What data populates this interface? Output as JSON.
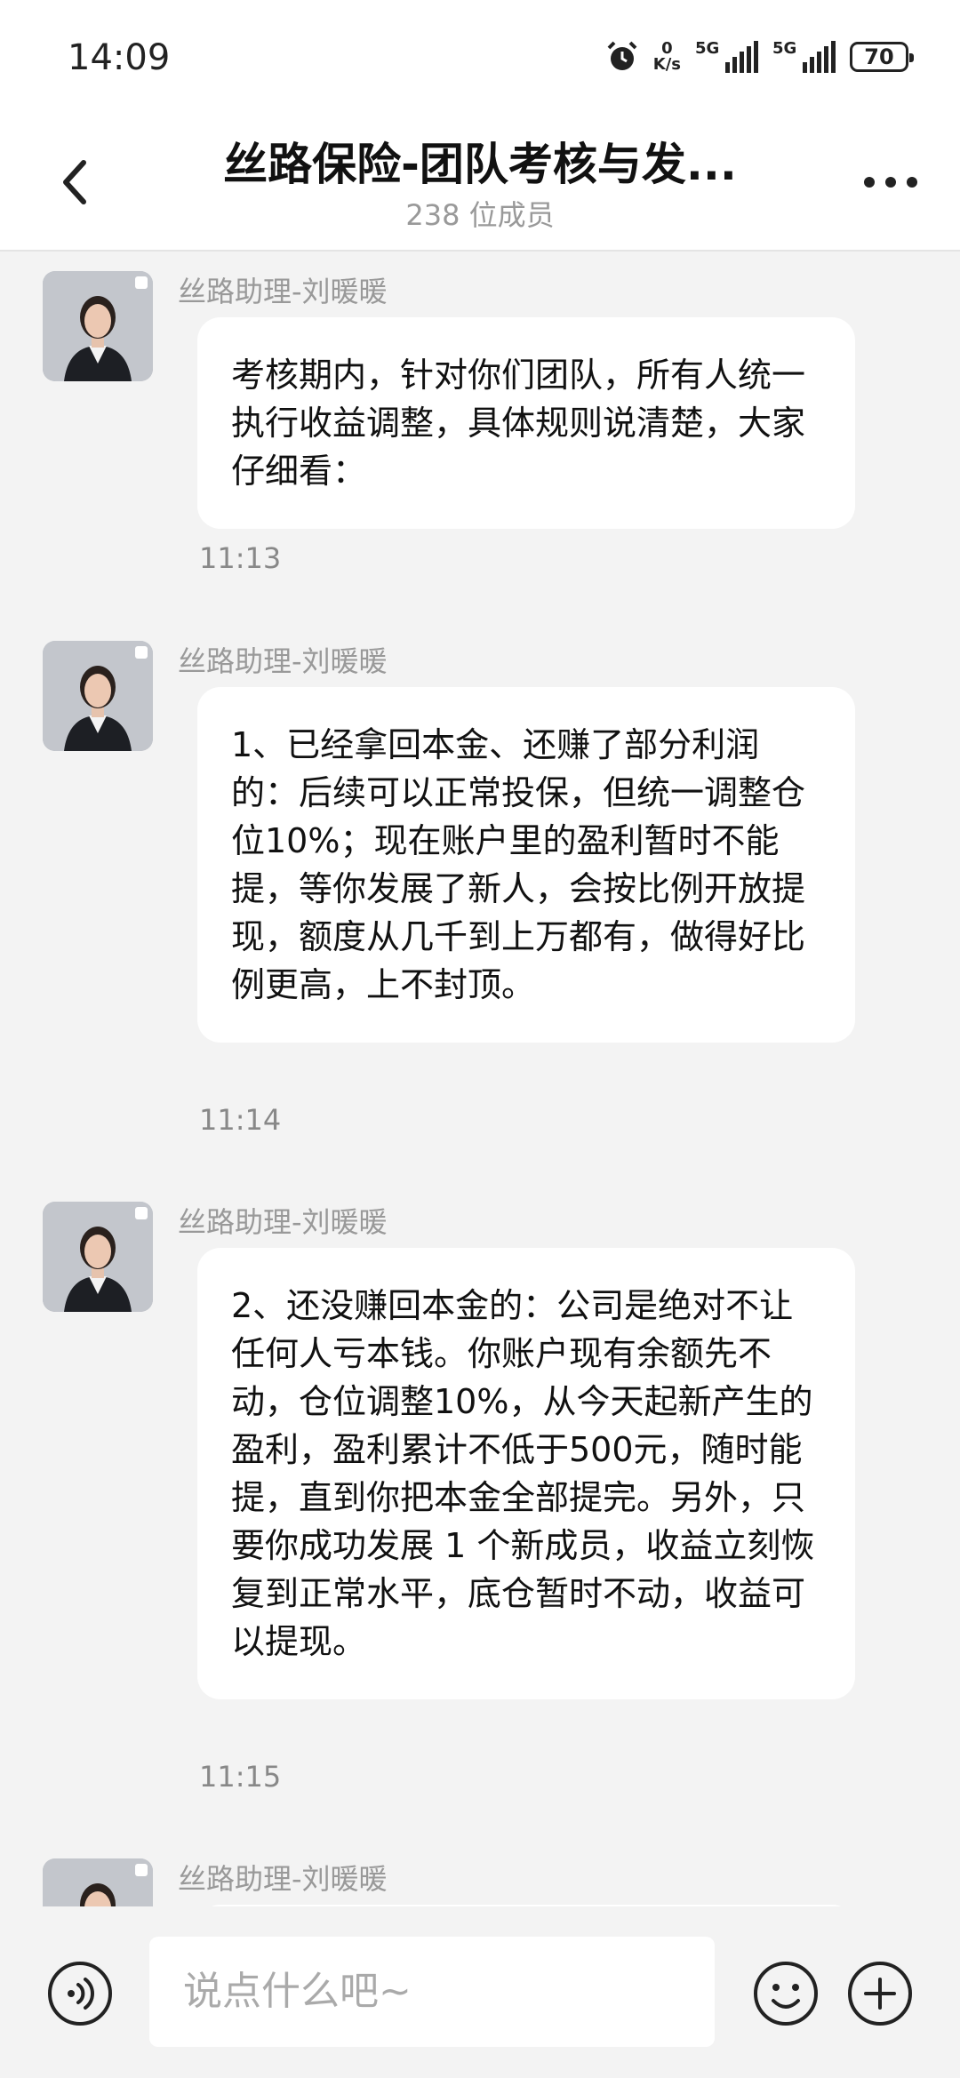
{
  "status": {
    "time": "14:09",
    "net_speed_value": "0",
    "net_speed_unit": "K/s",
    "sig1": "5G",
    "sig2": "5G",
    "battery": "70"
  },
  "header": {
    "title": "丝路保险-团队考核与发...",
    "members": "238 位成员"
  },
  "messages": [
    {
      "sender": "丝路助理-刘暖暖",
      "text": "考核期内，针对你们团队，所有人统一执行收益调整，具体规则说清楚，大家仔细看：",
      "time": "11:13"
    },
    {
      "sender": "丝路助理-刘暖暖",
      "text": "1、已经拿回本金、还赚了部分利润的：后续可以正常投保，但统一调整仓位10%；现在账户里的盈利暂时不能提，等你发展了新人，会按比例开放提现，额度从几千到上万都有，做得好比例更高，上不封顶。",
      "time": "11:14"
    },
    {
      "sender": "丝路助理-刘暖暖",
      "text": "2、还没赚回本金的：公司是绝对不让任何人亏本钱。你账户现有余额先不动，仓位调整10%，从今天起新产生的盈利，盈利累计不低于500元，随时能提，直到你把本金全部提完。另外，只要你成功发展 1 个新成员，收益立刻恢复到正常水平，底仓暂时不动，收益可以提现。",
      "time": "11:15"
    },
    {
      "sender": "丝路助理-刘暖暖"
    }
  ],
  "input": {
    "placeholder": "说点什么吧~"
  },
  "icons": {
    "back": "back-arrow-icon",
    "more": "more-dots-icon",
    "voice": "voice-icon",
    "emoji": "emoji-icon",
    "plus": "plus-icon"
  }
}
